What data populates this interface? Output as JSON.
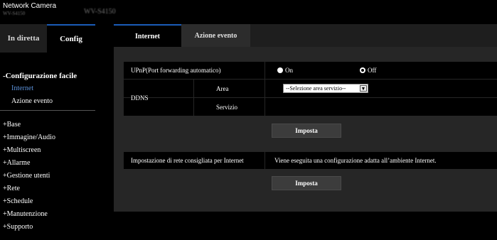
{
  "header": {
    "brand_title": "Network Camera",
    "brand_model": "WV-S4150",
    "model_title": "WV-S4150"
  },
  "sidebar": {
    "tabs": [
      {
        "label": "In diretta",
        "active": false
      },
      {
        "label": "Config",
        "active": true
      }
    ],
    "section_title": "-Configurazione facile",
    "sub_items": [
      {
        "label": "Internet",
        "active": true
      },
      {
        "label": "Azione evento",
        "active": false
      }
    ],
    "menu": [
      {
        "label": "+Base"
      },
      {
        "label": "+Immagine/Audio"
      },
      {
        "label": "+Multiscreen"
      },
      {
        "label": "+Allarme"
      },
      {
        "label": "+Gestione utenti"
      },
      {
        "label": "+Rete"
      },
      {
        "label": "+Schedule"
      },
      {
        "label": "+Manutenzione"
      },
      {
        "label": "+Supporto"
      }
    ]
  },
  "main": {
    "tabs": [
      {
        "label": "Internet",
        "active": true
      },
      {
        "label": "Azione evento",
        "active": false
      }
    ],
    "upnp": {
      "label": "UPnP(Port forwarding automatico)",
      "options": [
        {
          "label": "On",
          "selected": false
        },
        {
          "label": "Off",
          "selected": true
        }
      ]
    },
    "ddns": {
      "label": "DDNS",
      "area_label": "Area",
      "area_select_value": "--Selezione area servizio--",
      "servizio_label": "Servizio",
      "servizio_value": ""
    },
    "button_set_1": "Imposta",
    "recommended": {
      "label": "Impostazione di rete consigliata per Internet",
      "description": "Viene eseguita una configurazione adatta all’ambiente Internet."
    },
    "button_set_2": "Imposta"
  },
  "colors": {
    "accent_blue": "#1a5cb8",
    "active_link": "#5a8fd6",
    "panel_bg": "#262626"
  }
}
